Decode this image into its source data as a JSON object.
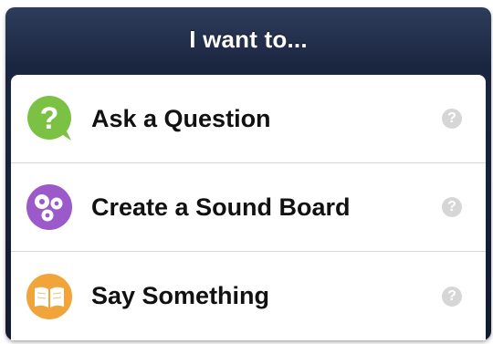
{
  "popover": {
    "title": "I want to..."
  },
  "menu": {
    "items": [
      {
        "label": "Ask a Question",
        "icon": "question-bubble-icon",
        "color": "#7bc143"
      },
      {
        "label": "Create a Sound Board",
        "icon": "sound-board-icon",
        "color": "#9b59c9"
      },
      {
        "label": "Say Something",
        "icon": "open-book-icon",
        "color": "#f0a43a"
      }
    ],
    "help_icon": "help-icon",
    "help_glyph": "?"
  }
}
